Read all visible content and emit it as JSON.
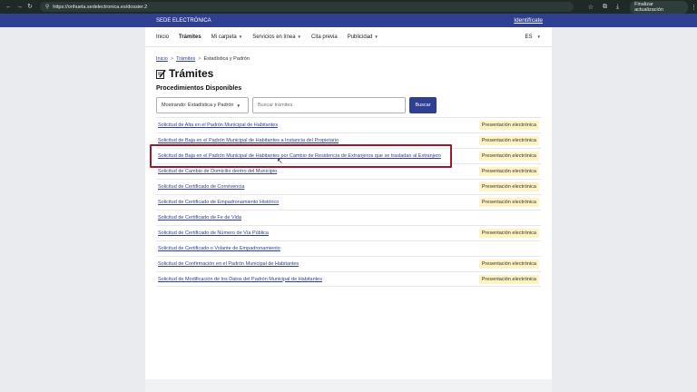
{
  "browser": {
    "url": "https://orihuela.sedelectronica.es/dossier.2",
    "update_label": "Finalizar actualización"
  },
  "site": {
    "name": "SEDE ELECTRÓNICA",
    "login_label": "Identifícate"
  },
  "nav": {
    "items": [
      {
        "label": "Inicio",
        "dropdown": false
      },
      {
        "label": "Trámites",
        "dropdown": false,
        "active": true
      },
      {
        "label": "Mi carpeta",
        "dropdown": true
      },
      {
        "label": "Servicios en línea",
        "dropdown": true
      },
      {
        "label": "Cita previa",
        "dropdown": false
      },
      {
        "label": "Publicidad",
        "dropdown": true
      }
    ],
    "language": "ES"
  },
  "breadcrumb": {
    "home": "Inicio",
    "section": "Trámites",
    "current": "Estadística y Padrón"
  },
  "page": {
    "title": "Trámites",
    "subtitle": "Procedimientos Disponibles"
  },
  "filters": {
    "showing": "Mostrando: Estadística y Padrón",
    "search_placeholder": "Buscar trámites",
    "search_button": "Buscar"
  },
  "procedures": [
    {
      "name": "Solicitud de Alta en el Padrón Municipal de Habitantes",
      "badge": "Presentación electrónica"
    },
    {
      "name": "Solicitud de Baja en el Padrón Municipal de Habitantes a Instancia del Propietario",
      "badge": "Presentación electrónica"
    },
    {
      "name": "Solicitud de Baja en el Padrón Municipal de Habitantes por Cambio de Residencia de Extranjeros que se trasladan al Extranjero",
      "badge": "Presentación electrónica"
    },
    {
      "name": "Solicitud de Cambio de Domicilio dentro del Municipio",
      "badge": "Presentación electrónica"
    },
    {
      "name": "Solicitud de Certificado de Convivencia",
      "badge": "Presentación electrónica"
    },
    {
      "name": "Solicitud de Certificado de Empadronamiento Histórico",
      "badge": "Presentación electrónica"
    },
    {
      "name": "Solicitud de Certificado de Fe de Vida",
      "badge": ""
    },
    {
      "name": "Solicitud de Certificado de Número de Vía Pública",
      "badge": "Presentación electrónica"
    },
    {
      "name": "Solicitud de Certificado o Volante de Empadronamiento",
      "badge": ""
    },
    {
      "name": "Solicitud de Confirmación en el Padrón Municipal de Habitantes",
      "badge": "Presentación electrónica"
    },
    {
      "name": "Solicitud de Modificación de los Datos del Padrón Municipal de Habitantes",
      "badge": "Presentación electrónica"
    }
  ],
  "colors": {
    "brand": "#2f3f91",
    "badge_bg": "#fff3c4",
    "highlight": "#9a1b2b"
  }
}
